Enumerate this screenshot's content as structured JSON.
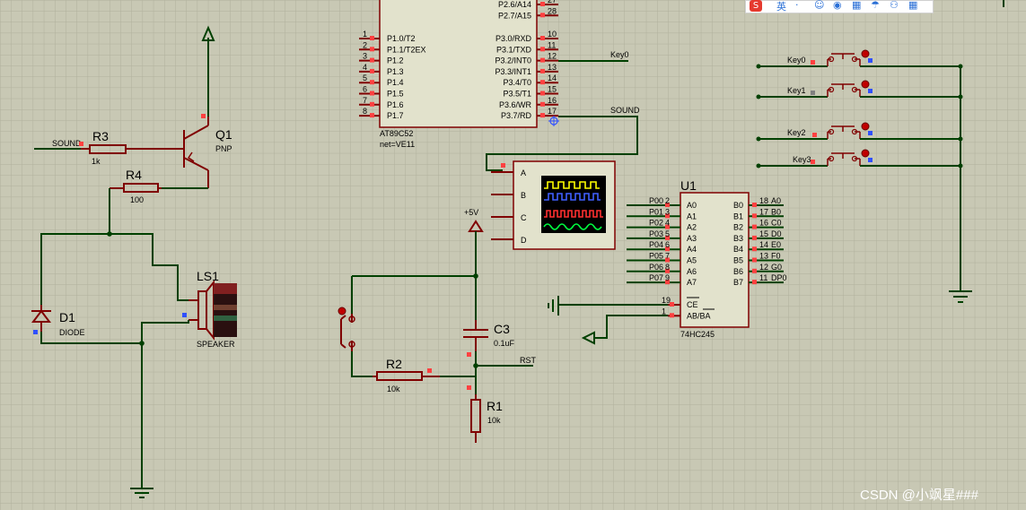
{
  "mcu": {
    "name": "AT89C52",
    "net": "net=VE11",
    "left_pins": [
      {
        "num": "1",
        "label": "P1.0/T2"
      },
      {
        "num": "2",
        "label": "P1.1/T2EX"
      },
      {
        "num": "3",
        "label": "P1.2"
      },
      {
        "num": "4",
        "label": "P1.3"
      },
      {
        "num": "5",
        "label": "P1.4"
      },
      {
        "num": "6",
        "label": "P1.5"
      },
      {
        "num": "7",
        "label": "P1.6"
      },
      {
        "num": "8",
        "label": "P1.7"
      }
    ],
    "right_top_pins": [
      {
        "num": "27",
        "label": "P2.6/A14"
      },
      {
        "num": "28",
        "label": "P2.7/A15"
      }
    ],
    "right_pins": [
      {
        "num": "10",
        "label": "P3.0/RXD"
      },
      {
        "num": "11",
        "label": "P3.1/TXD"
      },
      {
        "num": "12",
        "label": "P3.2/INT0"
      },
      {
        "num": "13",
        "label": "P3.3/INT1"
      },
      {
        "num": "14",
        "label": "P3.4/T0"
      },
      {
        "num": "15",
        "label": "P3.5/T1"
      },
      {
        "num": "16",
        "label": "P3.6/WR"
      },
      {
        "num": "17",
        "label": "P3.7/RD"
      }
    ]
  },
  "nets": {
    "key0": "Key0",
    "sound": "SOUND",
    "sound_in": "SOUND",
    "rst": "RST",
    "vcc": "+5V"
  },
  "transistor": {
    "ref": "Q1",
    "type": "PNP"
  },
  "resistors": [
    {
      "ref": "R3",
      "value": "1k"
    },
    {
      "ref": "R4",
      "value": "100"
    },
    {
      "ref": "R2",
      "value": "10k"
    },
    {
      "ref": "R1",
      "value": "10k"
    }
  ],
  "capacitor": {
    "ref": "C3",
    "value": "0.1uF"
  },
  "diode": {
    "ref": "D1",
    "type": "DIODE"
  },
  "speaker": {
    "ref": "LS1",
    "type": "SPEAKER"
  },
  "scope": {
    "channels": [
      "A",
      "B",
      "C",
      "D"
    ]
  },
  "buffer": {
    "ref": "U1",
    "part": "74HC245",
    "a_pins": [
      {
        "num": "2",
        "label": "A0",
        "net": "P00"
      },
      {
        "num": "3",
        "label": "A1",
        "net": "P01"
      },
      {
        "num": "4",
        "label": "A2",
        "net": "P02"
      },
      {
        "num": "5",
        "label": "A3",
        "net": "P03"
      },
      {
        "num": "6",
        "label": "A4",
        "net": "P04"
      },
      {
        "num": "7",
        "label": "A5",
        "net": "P05"
      },
      {
        "num": "8",
        "label": "A6",
        "net": "P06"
      },
      {
        "num": "9",
        "label": "A7",
        "net": "P07"
      }
    ],
    "b_pins": [
      {
        "num": "18",
        "label": "B0",
        "net": "A0"
      },
      {
        "num": "17",
        "label": "B1",
        "net": "B0"
      },
      {
        "num": "16",
        "label": "B2",
        "net": "C0"
      },
      {
        "num": "15",
        "label": "B3",
        "net": "D0"
      },
      {
        "num": "14",
        "label": "B4",
        "net": "E0"
      },
      {
        "num": "13",
        "label": "B5",
        "net": "F0"
      },
      {
        "num": "12",
        "label": "B6",
        "net": "G0"
      },
      {
        "num": "11",
        "label": "B7",
        "net": "DP0"
      }
    ],
    "ctrl_pins": [
      {
        "num": "19",
        "label": "CE"
      },
      {
        "num": "1",
        "label": "AB/BA"
      }
    ]
  },
  "keys": [
    "Key0",
    "Key1",
    "Key2",
    "Key3"
  ],
  "watermark": "CSDN @小飒星###",
  "ime_toolbar": [
    "英",
    "·",
    "☺",
    "◉",
    "▦",
    "☂",
    "⚇",
    "▦"
  ]
}
